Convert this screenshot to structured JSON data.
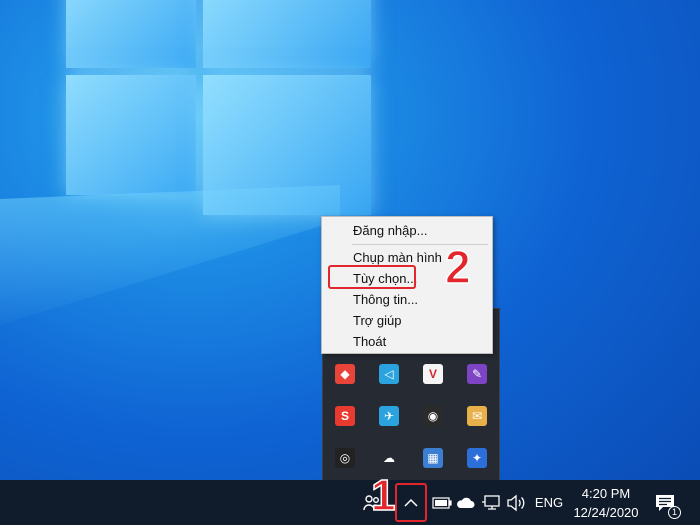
{
  "context_menu": {
    "items": [
      {
        "label": "Đăng nhập..."
      },
      {
        "label": "Chụp màn hình"
      },
      {
        "label": "Tùy chọn..."
      },
      {
        "label": "Thông tin..."
      },
      {
        "label": "Trợ giúp"
      },
      {
        "label": "Thoát"
      }
    ]
  },
  "annotations": {
    "step_1": "1",
    "step_2": "2",
    "highlight_color": "#e2262b"
  },
  "tray_overflow": {
    "icons": [
      {
        "name": "anydesk-icon",
        "color": "#e8443a",
        "glyph": "◆"
      },
      {
        "name": "telegram-icon",
        "color": "#2aa3df",
        "glyph": "◁"
      },
      {
        "name": "v-app-icon",
        "color": "#f5f5f5",
        "glyph": "V"
      },
      {
        "name": "feather-icon",
        "color": "#7d45c6",
        "glyph": "✎"
      },
      {
        "name": "snagit-icon",
        "color": "#e83a2f",
        "glyph": "S"
      },
      {
        "name": "telegram-icon-2",
        "color": "#2aa3df",
        "glyph": "✈"
      },
      {
        "name": "nvidia-icon",
        "color": "#2b2b2b",
        "glyph": "◉"
      },
      {
        "name": "mail-icon",
        "color": "#e8b04a",
        "glyph": "✉"
      },
      {
        "name": "screen-recorder-icon",
        "color": "#222222",
        "glyph": "◎"
      },
      {
        "name": "cloud-upload-icon",
        "color": "#262b33",
        "glyph": "☁"
      },
      {
        "name": "presentation-icon",
        "color": "#3c7fd2",
        "glyph": "▦"
      },
      {
        "name": "comet-icon",
        "color": "#2d6fd8",
        "glyph": "✦"
      }
    ]
  },
  "taskbar": {
    "language": "ENG",
    "time": "4:20 PM",
    "date": "12/24/2020",
    "notification_count": "1",
    "background": "#101c2c"
  }
}
